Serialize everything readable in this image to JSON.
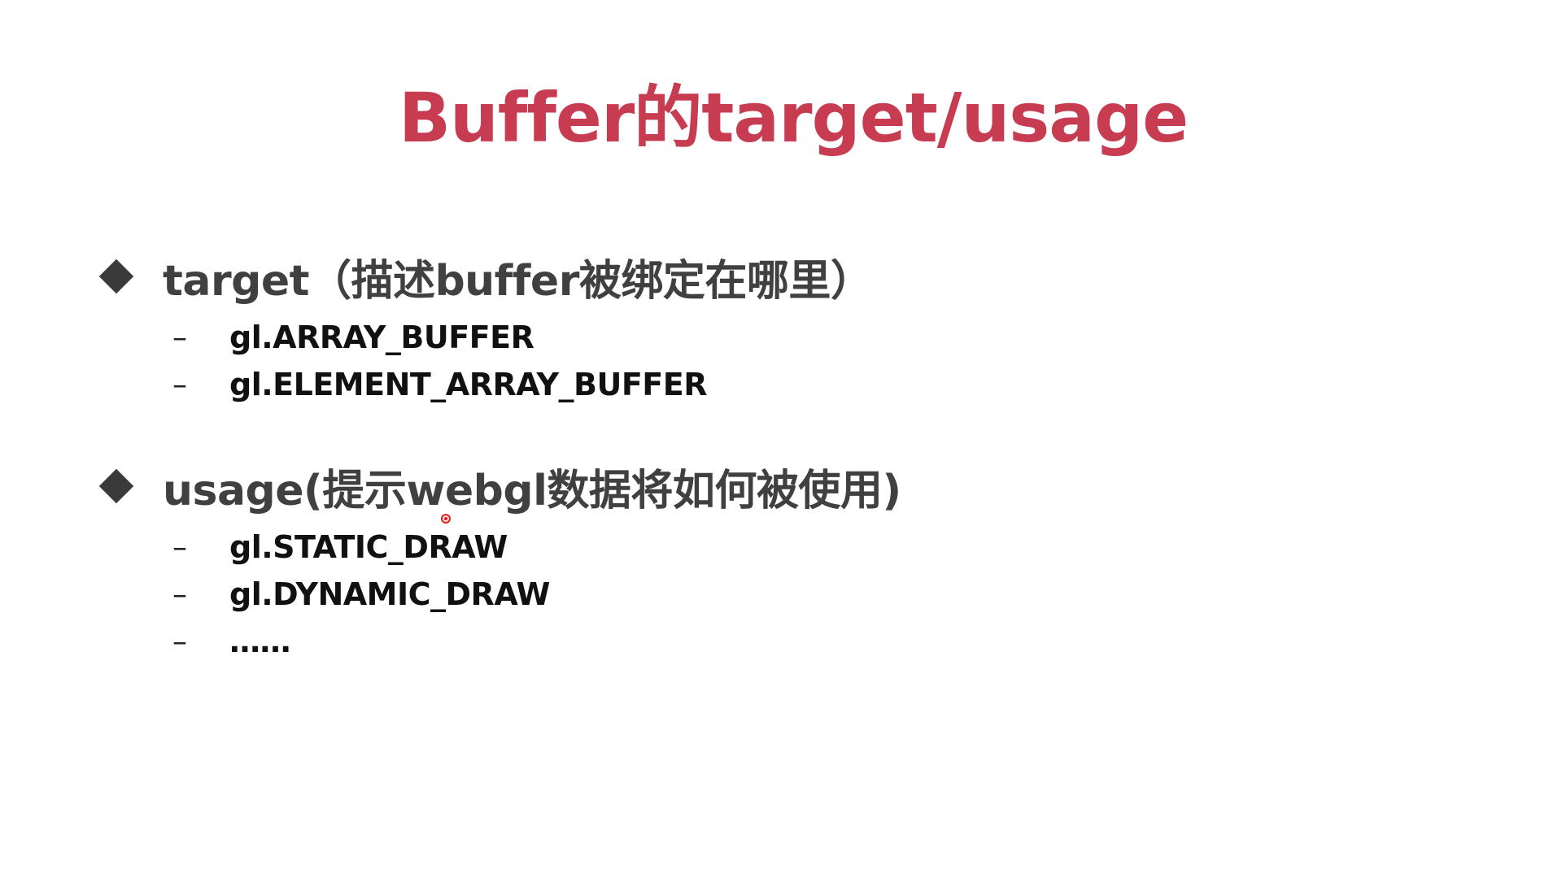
{
  "slide": {
    "title": "Buffer的target/usage",
    "title_color": "#c83c52",
    "sections": [
      {
        "bullet": "target（描述buffer被绑定在哪里）",
        "items": [
          {
            "text": "gl.ARRAY_BUFFER"
          },
          {
            "text": "gl.ELEMENT_ARRAY_BUFFER"
          }
        ]
      },
      {
        "bullet": "usage(提示webgl数据将如何被使用)",
        "items": [
          {
            "text": "gl.STATIC_DRAW"
          },
          {
            "text": "gl.DYNAMIC_DRAW"
          },
          {
            "text": "……"
          }
        ]
      }
    ],
    "dash_glyph": "–",
    "bullet_icon": "diamond-bullet-icon",
    "cursor_icon": "pointer-dot-icon"
  }
}
